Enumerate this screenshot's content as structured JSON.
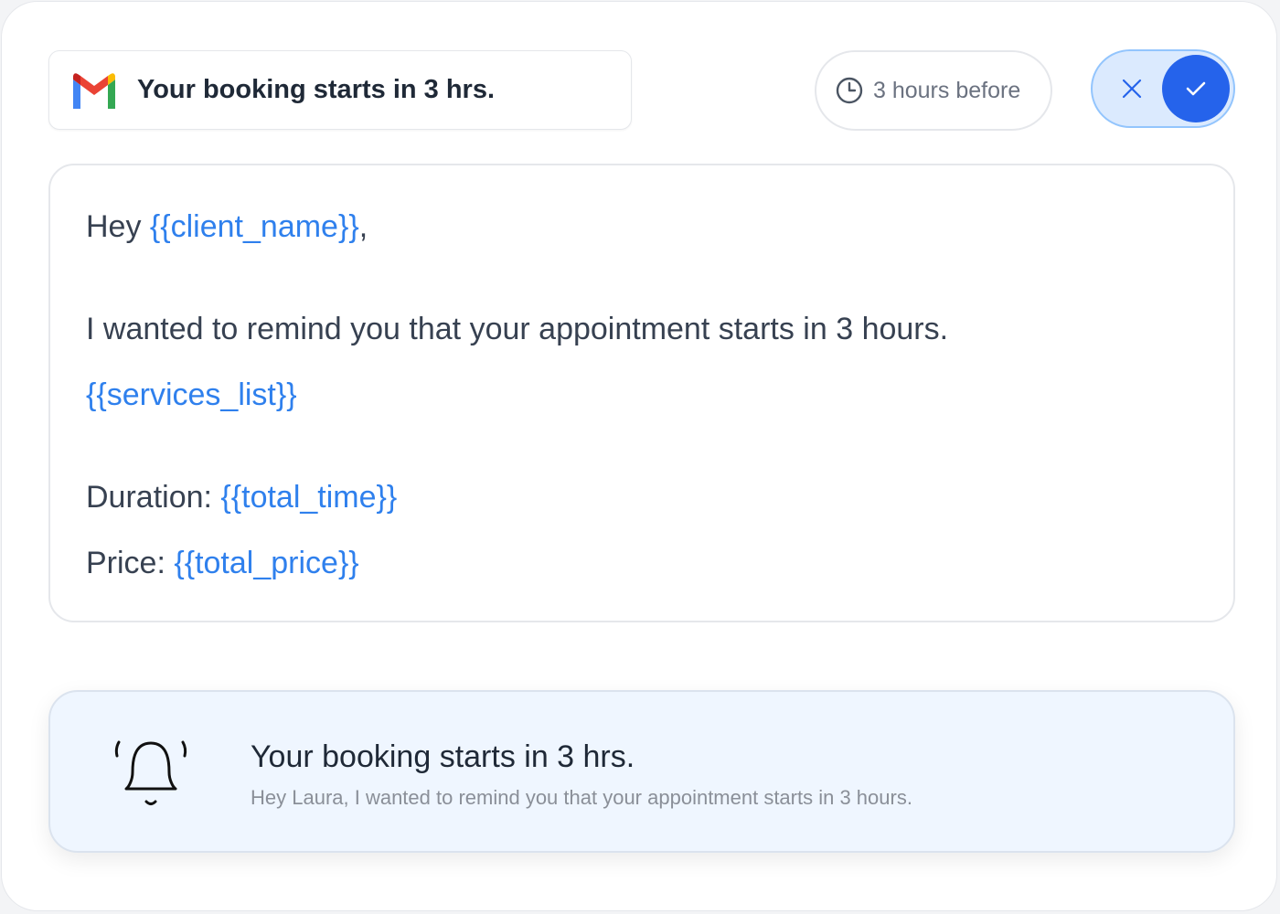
{
  "subject": {
    "icon": "gmail-icon",
    "text": "Your booking starts in 3 hrs."
  },
  "timing": {
    "icon": "clock-icon",
    "label": "3 hours before"
  },
  "toggle": {
    "state": "on",
    "off_icon": "x-icon",
    "on_icon": "check-icon",
    "accent": "#2563eb"
  },
  "message": {
    "greeting_prefix": "Hey ",
    "client_var": "{{client_name}}",
    "greeting_suffix": ",",
    "reminder": "I wanted to remind you that your appointment starts in 3 hours.",
    "services_var": "{{services_list}}",
    "duration_label": "Duration: ",
    "duration_var": "{{total_time}}",
    "price_label": "Price: ",
    "price_var": "{{total_price}}",
    "variable_color": "#2f80ed"
  },
  "notification": {
    "icon": "bell-icon",
    "title": "Your booking starts in 3 hrs.",
    "text": "Hey Laura, I wanted to remind you that your appointment starts in 3 hours."
  }
}
